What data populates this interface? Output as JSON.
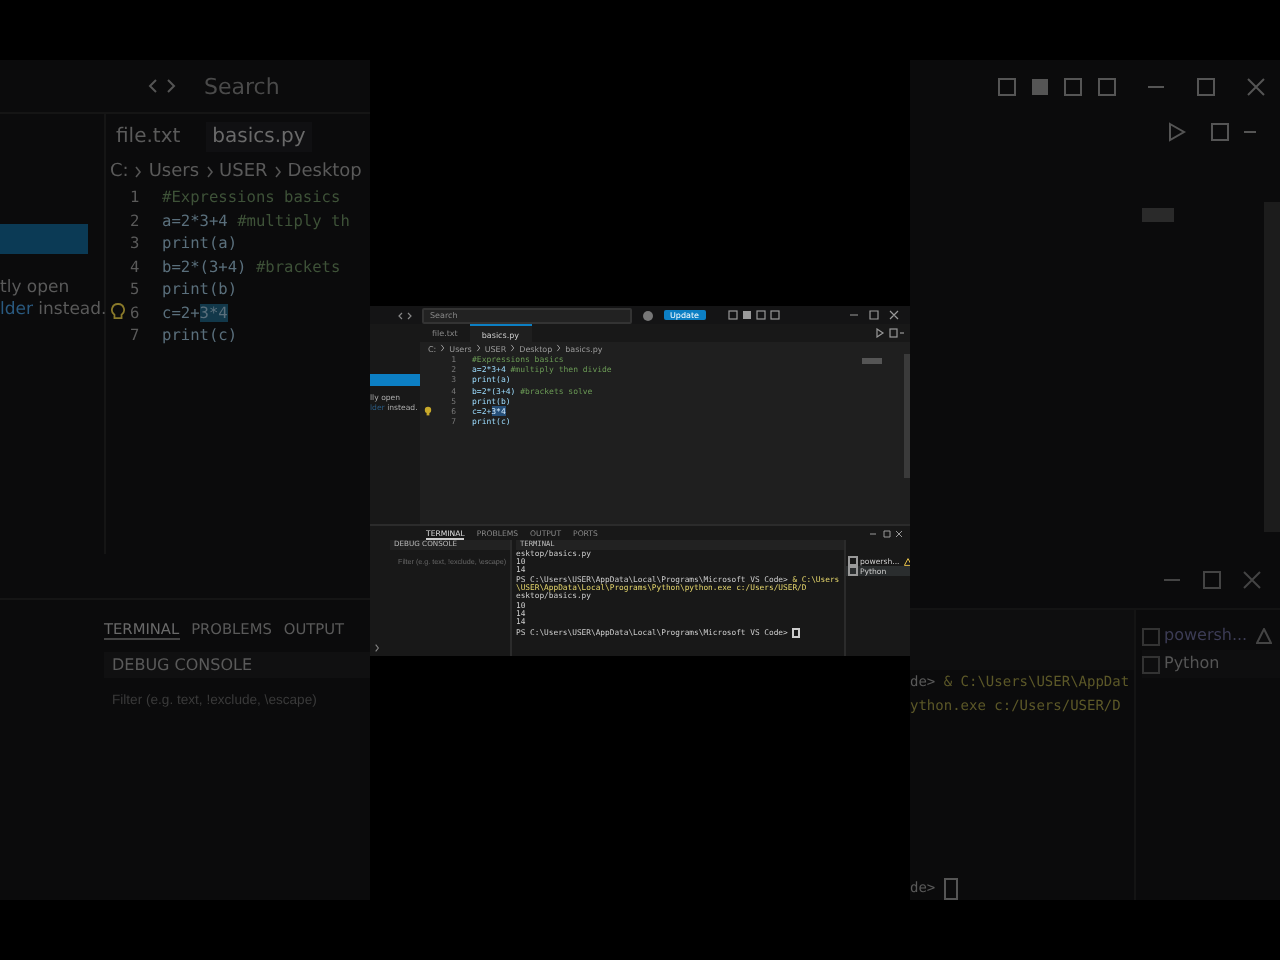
{
  "background_left": {
    "search": "Search",
    "tabs": [
      {
        "label": "file.txt",
        "selected": false
      },
      {
        "label": "basics.py",
        "selected": true
      }
    ],
    "breadcrumb": [
      "C:",
      "Users",
      "USER",
      "Desktop"
    ],
    "code": [
      {
        "n": "1",
        "comment": "#Expressions basics",
        "lightbulb": false
      },
      {
        "n": "2",
        "code": "a=2*3+4 ",
        "comment": "#multiply th",
        "lightbulb": false
      },
      {
        "n": "3",
        "code": "print(a)",
        "lightbulb": false
      },
      {
        "n": "4",
        "code": "b=2*(3+4) ",
        "comment": "#brackets",
        "lightbulb": false
      },
      {
        "n": "5",
        "code": "print(b)",
        "lightbulb": false
      },
      {
        "n": "6",
        "code": "c=2+",
        "selection": "3*4",
        "lightbulb": true
      },
      {
        "n": "7",
        "code": "print(c)",
        "lightbulb": false
      }
    ],
    "sidebar_text": "tly open",
    "sidebar_link": "lder",
    "sidebar_after_link": " instead.",
    "panel_tabs": [
      {
        "label": "TERMINAL",
        "selected": true
      },
      {
        "label": "PROBLEMS",
        "selected": false
      },
      {
        "label": "OUTPUT",
        "selected": false
      }
    ],
    "debug_console": "DEBUG CONSOLE",
    "filter_placeholder": "Filter (e.g. text, !exclude, \\escape)"
  },
  "window": {
    "search": "Search",
    "update_badge": "Update",
    "sidebar_text": "lly open",
    "sidebar_link": "lder",
    "sidebar_after_link": " instead.",
    "tabs": [
      {
        "label": "file.txt",
        "selected": false
      },
      {
        "label": "basics.py",
        "selected": true
      }
    ],
    "breadcrumb": [
      "C:",
      "Users",
      "USER",
      "Desktop",
      "basics.py"
    ],
    "code": [
      {
        "n": "1",
        "comment": "#Expressions basics",
        "lightbulb": false
      },
      {
        "n": "2",
        "code": "a=2*3+4 ",
        "comment": "#multiply then divide",
        "lightbulb": false
      },
      {
        "n": "3",
        "code": "print(a)",
        "lightbulb": false
      },
      {
        "n": "4",
        "code": "b=2*(3+4) ",
        "comment": "#brackets solve",
        "lightbulb": false
      },
      {
        "n": "5",
        "code": "print(b)",
        "lightbulb": false
      },
      {
        "n": "6",
        "code": "c=2+",
        "selection": "3*4",
        "lightbulb": true
      },
      {
        "n": "7",
        "code": "print(c)",
        "lightbulb": false
      }
    ],
    "panel_tabs": [
      {
        "label": "TERMINAL",
        "selected": true
      },
      {
        "label": "PROBLEMS",
        "selected": false
      },
      {
        "label": "OUTPUT",
        "selected": false
      },
      {
        "label": "PORTS",
        "selected": false
      }
    ],
    "debug_console": "DEBUG CONSOLE",
    "filter_placeholder": "Filter (e.g. text, !exclude, \\escape)",
    "terminal_title": "TERMINAL",
    "terminal_lines": [
      {
        "kind": "output",
        "text": "esktop/basics.py"
      },
      {
        "kind": "output",
        "text": "10"
      },
      {
        "kind": "output",
        "text": "14"
      },
      {
        "kind": "command",
        "prompt": "PS C:\\Users\\USER\\AppData\\Local\\Programs\\Microsoft VS Code> ",
        "text": "& C:\\Users\\USER\\AppData\\Local\\Programs\\Python\\python.exe c:/Users/USER/D"
      },
      {
        "kind": "output",
        "text": "esktop/basics.py"
      },
      {
        "kind": "output",
        "text": "10"
      },
      {
        "kind": "output",
        "text": "14"
      },
      {
        "kind": "output",
        "text": "14"
      },
      {
        "kind": "prompt",
        "prompt": "PS C:\\Users\\USER\\AppData\\Local\\Programs\\Microsoft VS Code> "
      }
    ],
    "terminals": [
      {
        "label": "powersh...",
        "selected": false,
        "warning": true
      },
      {
        "label": "Python",
        "selected": true,
        "warning": false
      }
    ]
  },
  "background_right": {
    "terminal_lines": [
      {
        "kind": "command",
        "prompt": "de> ",
        "text": "& C:\\Users\\USER\\AppDat"
      },
      {
        "kind": "output",
        "text": "ython.exe c:/Users/USER/D"
      }
    ],
    "last_prompt": "de> ",
    "terminals": [
      {
        "label": "powersh...",
        "selected": false,
        "warning": true
      },
      {
        "label": "Python",
        "selected": true,
        "warning": false
      }
    ]
  }
}
